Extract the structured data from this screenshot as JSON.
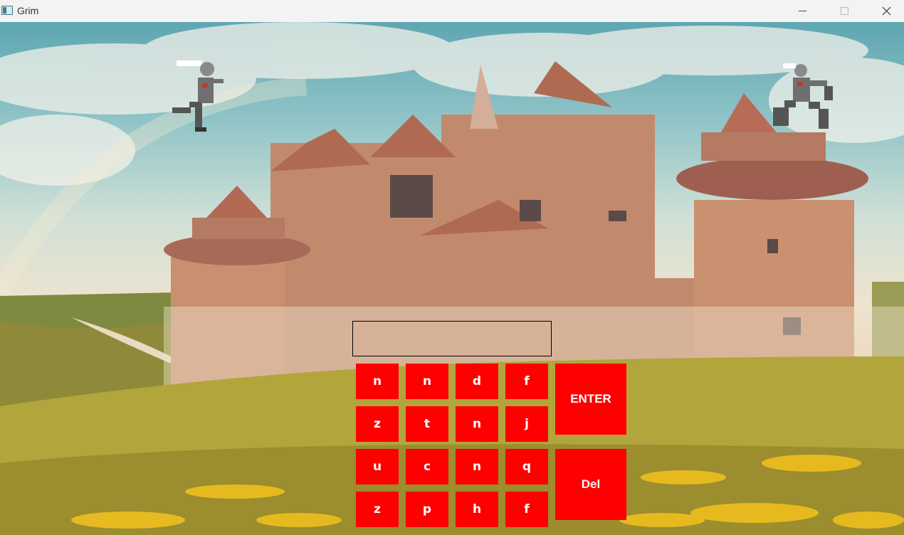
{
  "window": {
    "title": "Grim",
    "controls": [
      "minimize",
      "maximize",
      "close"
    ]
  },
  "game": {
    "entry_value": "",
    "keys": [
      [
        "n",
        "n",
        "d",
        "f"
      ],
      [
        "z",
        "t",
        "n",
        "j"
      ],
      [
        "u",
        "c",
        "n",
        "q"
      ],
      [
        "z",
        "p",
        "h",
        "f"
      ]
    ],
    "enter_label": "ENTER",
    "delete_label": "Del"
  },
  "colors": {
    "key_bg": "#ff0000",
    "key_text": "#ffffff"
  },
  "icons": [
    "app-icon",
    "minimize-icon",
    "maximize-icon",
    "close-icon",
    "ninja-sprite-left",
    "ninja-sprite-right"
  ]
}
